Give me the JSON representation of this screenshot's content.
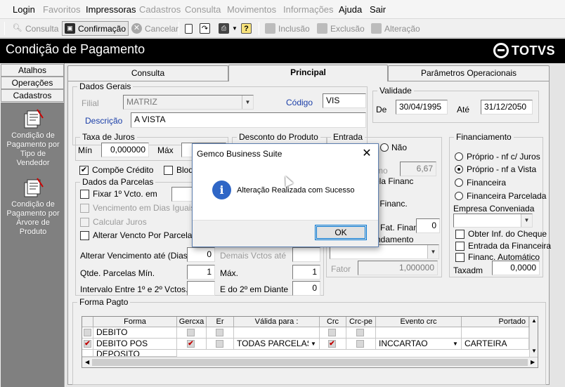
{
  "menu": {
    "items": [
      {
        "label": "Login",
        "enabled": true
      },
      {
        "label": "Favoritos",
        "enabled": false
      },
      {
        "label": "Impressoras",
        "enabled": true
      },
      {
        "label": "Cadastros",
        "enabled": false
      },
      {
        "label": "Consulta",
        "enabled": false
      },
      {
        "label": "Movimentos",
        "enabled": false
      },
      {
        "label": "Informações",
        "enabled": false
      },
      {
        "label": "Ajuda",
        "enabled": true
      },
      {
        "label": "Sair",
        "enabled": true
      }
    ]
  },
  "toolbar": {
    "consulta": "Consulta",
    "confirmacao": "Confirmação",
    "cancelar": "Cancelar",
    "inclusao": "Inclusão",
    "exclusao": "Exclusão",
    "alteracao": "Alteração"
  },
  "window": {
    "title": "Condição de Pagamento",
    "brand": "TOTVS"
  },
  "sidebar": {
    "tabs": [
      "Atalhos",
      "Operações",
      "Cadastros"
    ],
    "items": [
      {
        "label": "Condição de Pagamento por Tipo de Vendedor"
      },
      {
        "label": "Condição de Pagamento por Árvore de Produto"
      }
    ]
  },
  "tabs": {
    "consulta": "Consulta",
    "principal": "Principal",
    "parametros": "Parâmetros Operacionais"
  },
  "dados_gerais": {
    "title": "Dados Gerais",
    "filial_label": "Filial",
    "filial_value": "MATRIZ",
    "codigo_label": "Código",
    "codigo_value": "VIS",
    "descricao_label": "Descrição",
    "descricao_value": "A VISTA"
  },
  "validade": {
    "title": "Validade",
    "de_label": "De",
    "de_value": "30/04/1995",
    "ate_label": "Até",
    "ate_value": "31/12/2050"
  },
  "taxa_juros": {
    "title": "Taxa de Juros",
    "min_label": "Mín",
    "min_value": "0,000000",
    "max_label": "Máx"
  },
  "desconto": {
    "title": "Desconto do Produto"
  },
  "compoe_credito": "Compõe Crédito",
  "bloq_label": "Bloqu",
  "entrada": {
    "title": "Entrada",
    "nao_label": "Não",
    "mo_label": "mo",
    "mo_value": "6,67",
    "financ_label": "ela Financ",
    "financ2_label": "r Financ.",
    "fat_label": "Fat. Finan",
    "fat_value": "0",
    "arred_label": "ndamento",
    "fator_label": "Fator",
    "fator_value": "1,000000"
  },
  "financiamento": {
    "title": "Financiamento",
    "options": [
      {
        "label": "Próprio - nf c/ Juros",
        "selected": false
      },
      {
        "label": "Próprio - nf a Vista",
        "selected": true
      },
      {
        "label": "Financeira",
        "selected": false
      },
      {
        "label": "Financeira Parcelada",
        "selected": false
      }
    ],
    "empresa_label": "Empresa Conveniada",
    "checks": [
      {
        "label": "Obter Inf. do Cheque",
        "checked": false
      },
      {
        "label": "Entrada da Financeira",
        "checked": false
      },
      {
        "label": "Financ. Automático",
        "checked": false
      }
    ],
    "taxadm_label": "Taxadm",
    "taxadm_value": "0,0000"
  },
  "parcelas": {
    "title": "Dados da Parcelas",
    "fixar_label": "Fixar 1º Vcto. em",
    "venc_iguais_label": "Vencimento em Dias Iguais",
    "calcular_juros_label": "Calcular Juros",
    "alterar_vencto_label": "Alterar Vencto Por Parcela (Dia",
    "alterar_ate_label": "Alterar Vencimento até (Dias)",
    "alterar_ate_value": "0",
    "demais_label": "Demais Vctos até",
    "qtde_min_label": "Qtde. Parcelas Mín.",
    "qtde_min_value": "1",
    "max_label": "Máx.",
    "max_value": "1",
    "intervalo_label": "Intervalo Entre 1º e 2º Vctos.",
    "e_do_label": "E do 2º em Diante",
    "e_do_value": "0"
  },
  "forma_pagto": {
    "title": "Forma Pagto",
    "columns": [
      "Forma",
      "Gercxa",
      "Er",
      "Válida para :",
      "Crc",
      "Crc-pe",
      "Evento crc",
      "Portado"
    ],
    "rows": [
      {
        "selected": false,
        "forma": "DEBITO",
        "gercxa": false,
        "valida": "",
        "crc": false,
        "evento": "",
        "portador": ""
      },
      {
        "selected": true,
        "forma": "DEBITO POS",
        "gercxa": true,
        "valida": "TODAS PARCELAS",
        "crc": true,
        "evento": "INCCARTAO",
        "portador": "CARTEIRA"
      },
      {
        "selected": false,
        "forma": "DEPOSITO",
        "gercxa": false,
        "valida": "",
        "crc": false,
        "evento": "",
        "portador": ""
      }
    ]
  },
  "dialog": {
    "title": "Gemco Business Suite",
    "message": "Alteração Realizada com Sucesso",
    "ok": "OK"
  }
}
